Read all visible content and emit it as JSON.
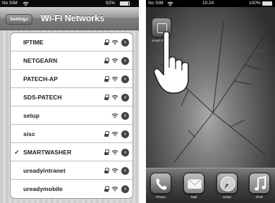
{
  "left_phone": {
    "status": {
      "carrier": "No SIM",
      "battery_pct": "92%"
    },
    "nav": {
      "back_label": "Settings",
      "title": "Wi-Fi Networks"
    },
    "networks": [
      {
        "name": "IPTIME",
        "selected": false,
        "secured": true
      },
      {
        "name": "NETGEARN",
        "selected": false,
        "secured": true
      },
      {
        "name": "PATECH-AP",
        "selected": false,
        "secured": true
      },
      {
        "name": "SDS-PATECH",
        "selected": false,
        "secured": true
      },
      {
        "name": "setup",
        "selected": false,
        "secured": false
      },
      {
        "name": "sisc",
        "selected": false,
        "secured": true
      },
      {
        "name": "SMARTWASHER",
        "selected": true,
        "secured": true
      },
      {
        "name": "ureadyintranet",
        "selected": false,
        "secured": true
      },
      {
        "name": "ureadymobile",
        "selected": false,
        "secured": true
      }
    ],
    "check_mark": "✓",
    "detail_glyph": "›"
  },
  "right_phone": {
    "status": {
      "carrier": "No SIM",
      "time": "10:24",
      "battery_pct": "100%"
    },
    "home_app": {
      "label": "Smart Player",
      "icon": "app-icon"
    },
    "dock": [
      {
        "label": "Phone",
        "icon": "phone-icon",
        "color": "#5a5a5a"
      },
      {
        "label": "Mail",
        "icon": "mail-icon",
        "color": "#8a8a8a"
      },
      {
        "label": "Safari",
        "icon": "compass-icon",
        "color": "#6e6e6e"
      },
      {
        "label": "iPod",
        "icon": "music-note-icon",
        "color": "#7a7a7a"
      }
    ],
    "page_count": 3,
    "current_page": 2
  }
}
